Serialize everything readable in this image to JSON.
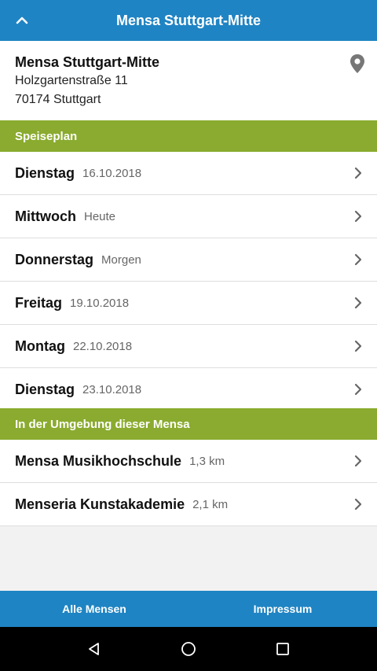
{
  "topbar": {
    "title": "Mensa Stuttgart-Mitte",
    "back_icon": "chevron-up-icon"
  },
  "mensa": {
    "name": "Mensa Stuttgart-Mitte",
    "street": "Holzgartenstraße 11",
    "city": "70174 Stuttgart",
    "pin_icon": "location-pin-icon"
  },
  "speiseplan": {
    "header": "Speiseplan",
    "days": [
      {
        "day": "Dienstag",
        "date": "16.10.2018"
      },
      {
        "day": "Mittwoch",
        "date": "Heute"
      },
      {
        "day": "Donnerstag",
        "date": "Morgen"
      },
      {
        "day": "Freitag",
        "date": "19.10.2018"
      },
      {
        "day": "Montag",
        "date": "22.10.2018"
      },
      {
        "day": "Dienstag",
        "date": "23.10.2018"
      }
    ]
  },
  "nearby": {
    "header": "In der Umgebung dieser Mensa",
    "items": [
      {
        "name": "Mensa Musikhochschule",
        "distance": "1,3 km"
      },
      {
        "name": "Menseria Kunstakademie",
        "distance": "2,1 km"
      }
    ]
  },
  "bottombar": {
    "all_label": "Alle Mensen",
    "impressum_label": "Impressum"
  },
  "colors": {
    "primary": "#1f84c3",
    "section": "#8aab2f"
  }
}
